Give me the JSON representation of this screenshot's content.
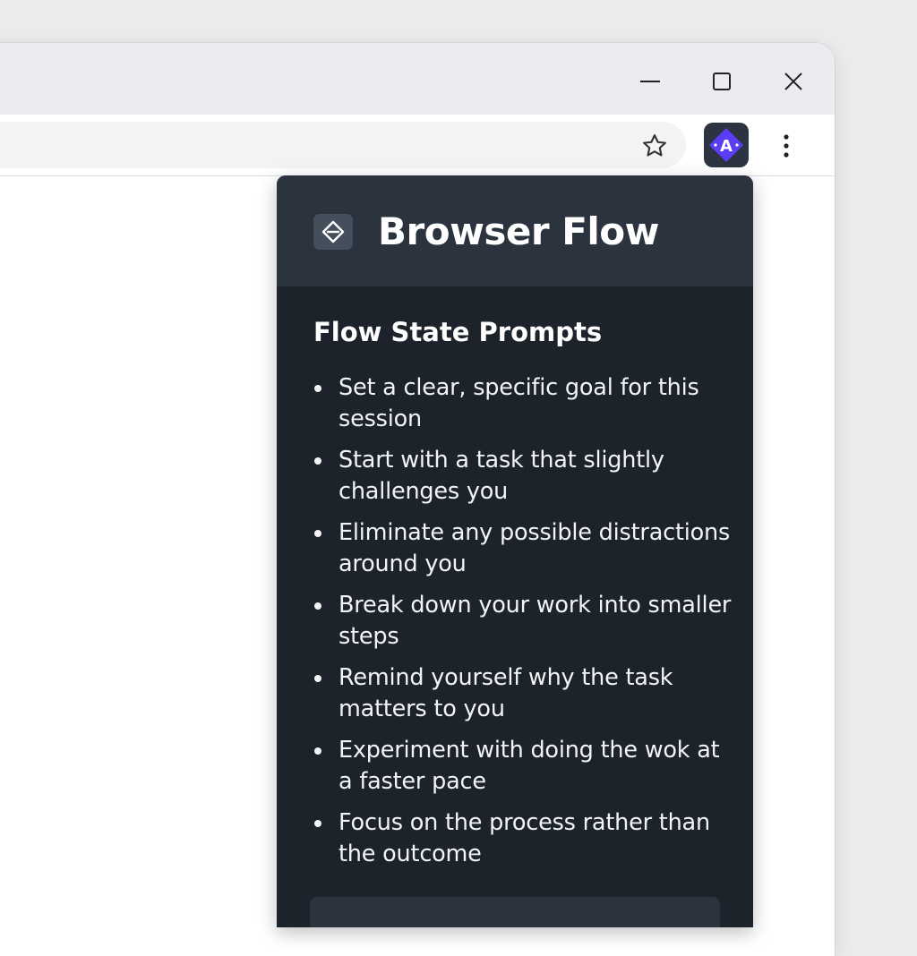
{
  "browser": {
    "window_controls": {
      "minimize_icon": "minimize-icon",
      "maximize_icon": "maximize-icon",
      "close_icon": "close-icon"
    },
    "toolbar": {
      "bookmark_icon": "star-icon",
      "extension_icon": "browser-flow-extension-icon",
      "extension_letter": "A",
      "menu_icon": "kebab-menu-icon"
    }
  },
  "popup": {
    "title": "Browser Flow",
    "logo_icon": "diamond-logo-icon",
    "section_title": "Flow State Prompts",
    "prompts": [
      "Set a clear, specific goal for this session",
      "Start with a task that slightly challenges you",
      "Eliminate any possible distractions around you",
      "Break down your work into smaller steps",
      "Remind yourself why the task matters to you",
      "Experiment with doing the wok at a faster pace",
      "Focus on the process rather than the outcome"
    ]
  },
  "colors": {
    "popup_background": "#1d232b",
    "popup_header": "#2b333e",
    "extension_accent": "#5b3df5",
    "titlebar": "#eaecef"
  }
}
